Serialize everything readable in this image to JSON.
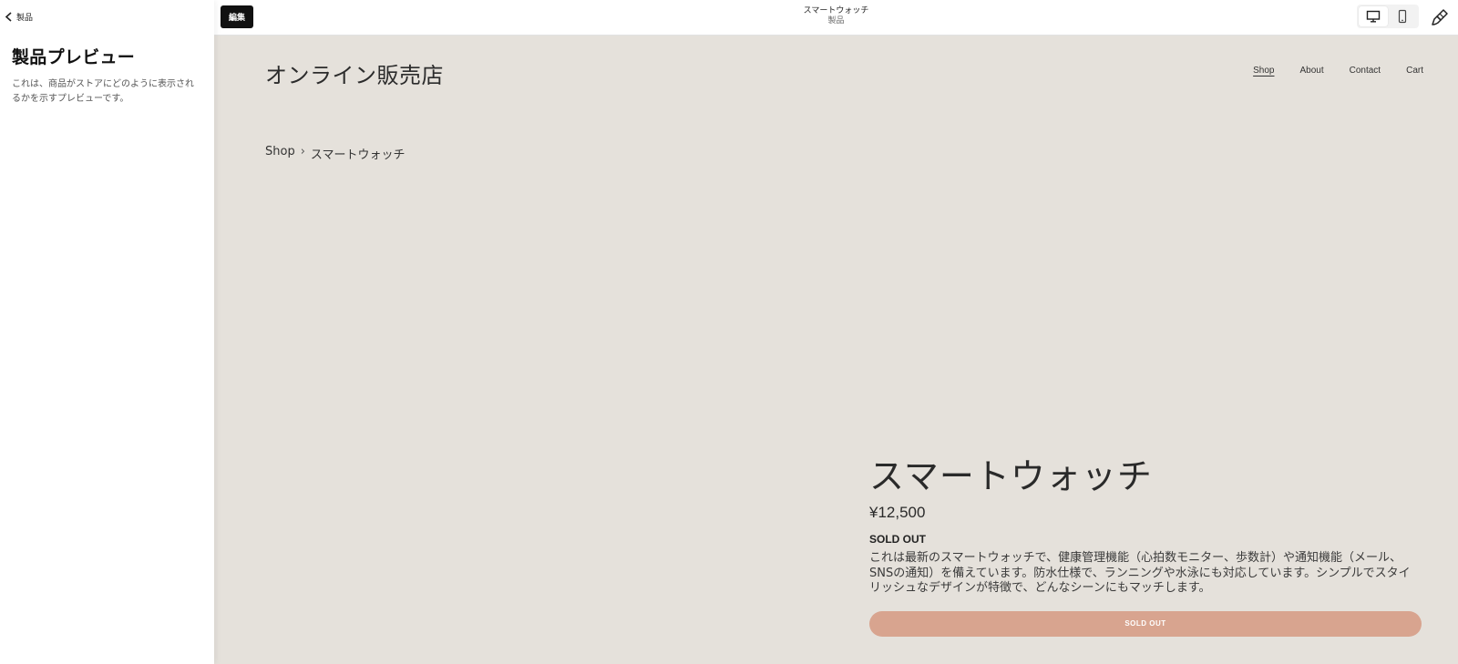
{
  "left_panel": {
    "back_label": "製品",
    "title": "製品プレビュー",
    "description": "これは、商品がストアにどのように表示されるかを示すプレビューです。"
  },
  "topbar": {
    "edit_label": "編集",
    "title": "スマートウォッチ",
    "subtitle": "製品",
    "device_icons": [
      "desktop-icon",
      "mobile-icon"
    ],
    "design_icon": "paintbrush-icon"
  },
  "preview": {
    "site_title": "オンライン販売店",
    "nav": [
      {
        "label": "Shop",
        "current": true
      },
      {
        "label": "About",
        "current": false
      },
      {
        "label": "Contact",
        "current": false
      },
      {
        "label": "Cart",
        "current": false
      }
    ],
    "breadcrumb": {
      "root": "Shop",
      "separator": "›",
      "current": "スマートウォッチ"
    },
    "product": {
      "name": "スマートウォッチ",
      "price": "¥12,500",
      "status": "SOLD OUT",
      "description": "これは最新のスマートウォッチで、健康管理機能（心拍数モニター、歩数計）や通知機能（メール、SNSの通知）を備えています。防水仕様で、ランニングや水泳にも対応しています。シンプルでスタイリッシュなデザインが特徴で、どんなシーンにもマッチします。",
      "button_label": "SOLD OUT"
    },
    "colors": {
      "background": "#e5e1db",
      "button": "#d8a48f"
    }
  }
}
